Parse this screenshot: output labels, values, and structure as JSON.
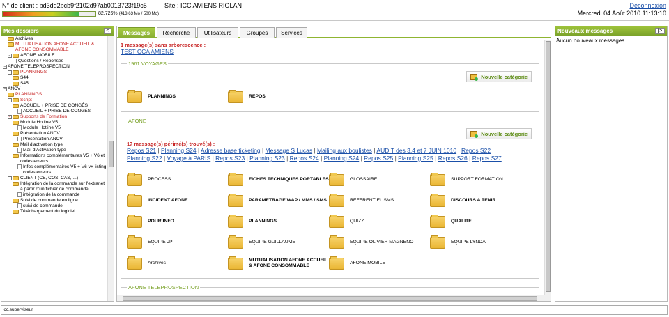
{
  "header": {
    "client_label": "N° de client :",
    "client_id": "bd3dd2bcb9f2102d97ab0013723f19c5",
    "site_label": "Site :",
    "site_name": "ICC AMIENS RIOLAN",
    "quota_percent_text": "82.726%",
    "quota_percent": 82.726,
    "quota_detail": "(413.63 Mo / 500 Mo)",
    "logout": "Déconnexion",
    "datetime": "Mercredi 04 Août 2010 11:13:10"
  },
  "left_panel": {
    "title": "Mes dossiers",
    "toggle": "<",
    "tree": [
      {
        "text": "Archives",
        "type": "folder",
        "indent": 1,
        "color": "black"
      },
      {
        "text": "MUTUALISATION AFONE ACCUEIL & AFONE CONSOMMABLE",
        "type": "folder",
        "indent": 1,
        "color": "red"
      },
      {
        "text": "AFONE MOBILE",
        "type": "folder",
        "indent": 1,
        "color": "black",
        "box": "−"
      },
      {
        "text": "Questions / Réponses",
        "type": "doc",
        "indent": 2,
        "color": "black"
      },
      {
        "text": "AFONE TELEPROSPECTION",
        "type": "root",
        "indent": 0,
        "color": "black",
        "box": "−"
      },
      {
        "text": "PLANNINGS",
        "type": "folder",
        "indent": 1,
        "color": "red",
        "box": "−"
      },
      {
        "text": "S44",
        "type": "folder",
        "indent": 2,
        "color": "black"
      },
      {
        "text": "S45",
        "type": "folder",
        "indent": 2,
        "color": "black"
      },
      {
        "text": "ANCV",
        "type": "root",
        "indent": 0,
        "color": "black",
        "box": "−"
      },
      {
        "text": "PLANNINGS",
        "type": "folder",
        "indent": 1,
        "color": "red"
      },
      {
        "text": "Script",
        "type": "folder",
        "indent": 1,
        "color": "red",
        "box": "−"
      },
      {
        "text": "ACCUEIL + PRISE DE CONGÉS",
        "type": "folder",
        "indent": 2,
        "color": "black"
      },
      {
        "text": "ACCUEIL + PRISE DE CONGÉS",
        "type": "doc",
        "indent": 3,
        "color": "black"
      },
      {
        "text": "Supports de Formation",
        "type": "folder",
        "indent": 1,
        "color": "red",
        "box": "−"
      },
      {
        "text": "Module Hotline V5",
        "type": "folder",
        "indent": 2,
        "color": "black"
      },
      {
        "text": "Module Hotline V5",
        "type": "doc",
        "indent": 3,
        "color": "black"
      },
      {
        "text": "Présentation ANCV",
        "type": "folder",
        "indent": 2,
        "color": "black"
      },
      {
        "text": "Présentation ANCV",
        "type": "doc",
        "indent": 3,
        "color": "black"
      },
      {
        "text": "Mail d'activation type",
        "type": "folder",
        "indent": 2,
        "color": "black"
      },
      {
        "text": "Mail d'Activation type",
        "type": "doc",
        "indent": 3,
        "color": "black"
      },
      {
        "text": "Informations complémentaires V5 + V6 et codes erreurs",
        "type": "folder",
        "indent": 2,
        "color": "black"
      },
      {
        "text": "Infos complémentaires V5 + V6 v+ listing codes erreurs",
        "type": "doc",
        "indent": 3,
        "color": "black"
      },
      {
        "text": "CLIENT (CE, COS, CAS, ...)",
        "type": "folder",
        "indent": 1,
        "color": "black",
        "box": "−"
      },
      {
        "text": "Intégration de la commande sur l'extranet à partir d'un fichier de commande",
        "type": "folder",
        "indent": 2,
        "color": "black"
      },
      {
        "text": "intégration de la commande",
        "type": "doc",
        "indent": 3,
        "color": "black"
      },
      {
        "text": "Suivi de commande en ligne",
        "type": "folder",
        "indent": 2,
        "color": "black"
      },
      {
        "text": "suivi de commande",
        "type": "doc",
        "indent": 3,
        "color": "black"
      },
      {
        "text": "Téléchargement du logiciel",
        "type": "folder",
        "indent": 2,
        "color": "black"
      }
    ]
  },
  "tabs": [
    "Messages",
    "Recherche",
    "Utilisateurs",
    "Groupes",
    "Services"
  ],
  "content": {
    "no_tree_title": "1 message(s) sans arborescence :",
    "no_tree_link": "TEST CCA AMIENS",
    "new_category": "Nouvelle catégorie",
    "sections": [
      {
        "legend": "1961 VOYAGES",
        "categories": [
          {
            "label": "PLANNINGS",
            "bold": true
          },
          {
            "label": "REPOS",
            "bold": true
          }
        ]
      },
      {
        "legend": "AFONE",
        "perime": "17 message(s) périmé(s) trouvé(s) :",
        "links_line1": [
          "Repos S21",
          "Planning S24",
          "Adresse base ticketing",
          "Message S Lucas",
          "Mailing aux boulistes",
          "AUDIT des 3,4 et 7 JUIN 1010",
          "Repos S22"
        ],
        "links_line2": [
          "Planning S22",
          "Voyage à PARIS",
          "Repos S23",
          "Planning S23",
          "Repos S24",
          "Planning S24",
          "Repos S25",
          "Planning S25",
          "Repos S26",
          "Repos S27"
        ],
        "categories": [
          {
            "label": "PROCESS",
            "bold": false
          },
          {
            "label": "FICHES TECHNIQUES PORTABLES",
            "bold": true
          },
          {
            "label": "GLOSSAIRE",
            "bold": false
          },
          {
            "label": "SUPPORT FORMATION",
            "bold": false
          },
          {
            "label": "INCIDENT AFONE",
            "bold": true
          },
          {
            "label": "PARAMETRAGE WAP / MMS / SMS",
            "bold": true
          },
          {
            "label": "REFERENTIEL SMS",
            "bold": false
          },
          {
            "label": "DISCOURS A TENIR",
            "bold": true
          },
          {
            "label": "POUR INFO",
            "bold": true
          },
          {
            "label": "PLANNINGS",
            "bold": true
          },
          {
            "label": "QUIZZ",
            "bold": false
          },
          {
            "label": "QUALITE",
            "bold": true
          },
          {
            "label": "EQUIPE JP",
            "bold": false
          },
          {
            "label": "EQUIPE GUILLAUME",
            "bold": false
          },
          {
            "label": "EQUIPE OLIVIER MAGNENOT",
            "bold": false
          },
          {
            "label": "EQUIPE LYNDA",
            "bold": false
          },
          {
            "label": "Archives",
            "bold": false
          },
          {
            "label": "MUTUALISATION AFONE ACCUEIL & AFONE CONSOMMABLE",
            "bold": true
          },
          {
            "label": "AFONE MOBILE",
            "bold": false
          }
        ]
      },
      {
        "legend": "AFONE TELEPROSPECTION",
        "categories": []
      }
    ]
  },
  "right_panel": {
    "title": "Nouveaux messages",
    "toggle": "[>",
    "empty_text": "Aucun nouveaux messages"
  },
  "status": {
    "text": "icc.superviseur"
  },
  "colors": {
    "accent_green": "#8fb531",
    "red_text": "#c62020",
    "link_blue": "#1a4fa8"
  }
}
